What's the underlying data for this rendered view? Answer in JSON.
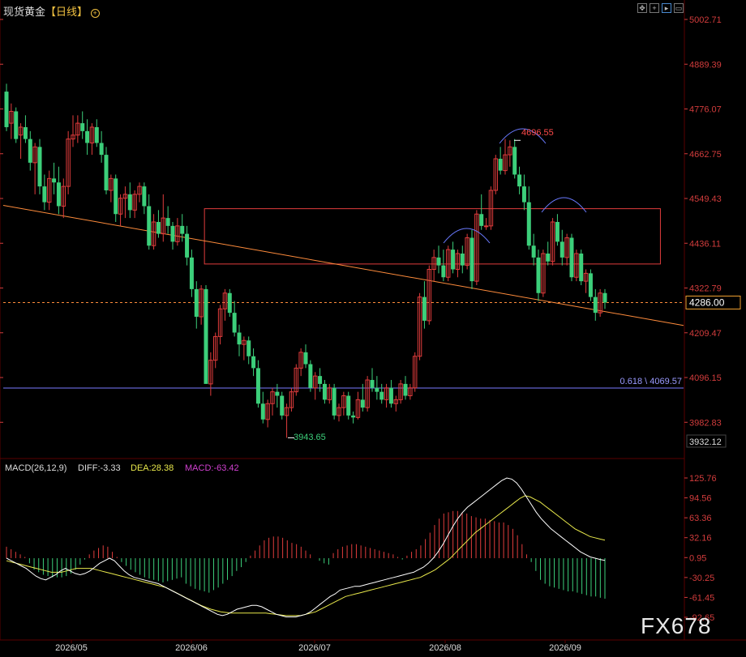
{
  "header": {
    "title": "现货黄金",
    "period": "【日线】",
    "settings_icon": "circle-plus-icon"
  },
  "toolbar": {
    "icons": [
      "move-icon",
      "crosshair-icon",
      "chart-mode-icon",
      "expand-icon"
    ]
  },
  "current_price": "4286.00",
  "watermark": "FX678",
  "colors": {
    "up": "#e03c3c",
    "down": "#3ccf7a",
    "grid": "#5a0000",
    "axis_text": "#d23c3c",
    "trend": "#ff8c3c",
    "fib": "#7a7aff",
    "box": "#e03c3c",
    "diff": "#ffffff",
    "dea": "#e8e84b",
    "arc": "#6a7aff"
  },
  "chart_data": [
    {
      "type": "candlestick",
      "title": "",
      "price_ticks": [
        "5002.71",
        "4889.39",
        "4776.07",
        "4662.75",
        "4549.43",
        "4436.11",
        "4322.79",
        "4209.47",
        "4096.15",
        "3982.83"
      ],
      "ylim": [
        3932.12,
        5002.71
      ],
      "ymin_label": "3932.12",
      "x_labels": [
        "2026/05",
        "2026/06",
        "2026/07",
        "2026/08",
        "2026/09"
      ],
      "annotations": {
        "high": "4696.55",
        "low": "3943.65",
        "fib": "0.618 \\ 4069.57"
      },
      "candles": [
        [
          4820,
          4840,
          4720,
          4730
        ],
        [
          4740,
          4790,
          4700,
          4770
        ],
        [
          4770,
          4780,
          4690,
          4700
        ],
        [
          4710,
          4740,
          4650,
          4730
        ],
        [
          4730,
          4760,
          4690,
          4700
        ],
        [
          4700,
          4720,
          4620,
          4640
        ],
        [
          4640,
          4690,
          4560,
          4680
        ],
        [
          4680,
          4700,
          4560,
          4580
        ],
        [
          4580,
          4610,
          4520,
          4540
        ],
        [
          4540,
          4620,
          4520,
          4600
        ],
        [
          4600,
          4640,
          4560,
          4590
        ],
        [
          4590,
          4630,
          4510,
          4530
        ],
        [
          4530,
          4600,
          4500,
          4580
        ],
        [
          4580,
          4720,
          4560,
          4700
        ],
        [
          4700,
          4760,
          4680,
          4710
        ],
        [
          4710,
          4760,
          4690,
          4740
        ],
        [
          4740,
          4770,
          4700,
          4720
        ],
        [
          4720,
          4750,
          4660,
          4690
        ],
        [
          4690,
          4740,
          4660,
          4730
        ],
        [
          4730,
          4750,
          4680,
          4690
        ],
        [
          4690,
          4720,
          4640,
          4660
        ],
        [
          4660,
          4680,
          4560,
          4570
        ],
        [
          4570,
          4610,
          4540,
          4600
        ],
        [
          4600,
          4610,
          4490,
          4510
        ],
        [
          4510,
          4560,
          4480,
          4550
        ],
        [
          4550,
          4580,
          4500,
          4560
        ],
        [
          4560,
          4590,
          4500,
          4520
        ],
        [
          4520,
          4570,
          4500,
          4560
        ],
        [
          4560,
          4590,
          4540,
          4580
        ],
        [
          4580,
          4590,
          4510,
          4530
        ],
        [
          4530,
          4560,
          4420,
          4430
        ],
        [
          4430,
          4510,
          4420,
          4490
        ],
        [
          4490,
          4520,
          4450,
          4460
        ],
        [
          4460,
          4560,
          4440,
          4500
        ],
        [
          4500,
          4530,
          4460,
          4480
        ],
        [
          4480,
          4490,
          4420,
          4440
        ],
        [
          4440,
          4500,
          4430,
          4480
        ],
        [
          4480,
          4510,
          4440,
          4460
        ],
        [
          4460,
          4480,
          4380,
          4400
        ],
        [
          4400,
          4420,
          4300,
          4320
        ],
        [
          4320,
          4340,
          4220,
          4250
        ],
        [
          4250,
          4330,
          4230,
          4320
        ],
        [
          4320,
          4330,
          4100,
          4080
        ],
        [
          4080,
          4160,
          4050,
          4140
        ],
        [
          4140,
          4210,
          4120,
          4200
        ],
        [
          4200,
          4280,
          4180,
          4270
        ],
        [
          4270,
          4320,
          4240,
          4310
        ],
        [
          4310,
          4320,
          4250,
          4260
        ],
        [
          4260,
          4290,
          4200,
          4210
        ],
        [
          4210,
          4230,
          4150,
          4180
        ],
        [
          4180,
          4200,
          4140,
          4190
        ],
        [
          4190,
          4200,
          4130,
          4150
        ],
        [
          4150,
          4170,
          4100,
          4120
        ],
        [
          4120,
          4140,
          4020,
          4030
        ],
        [
          4030,
          4060,
          3980,
          3990
        ],
        [
          3990,
          4040,
          3970,
          4030
        ],
        [
          4030,
          4070,
          4000,
          4060
        ],
        [
          4060,
          4080,
          4020,
          4050
        ],
        [
          4050,
          4060,
          3990,
          4000
        ],
        [
          4000,
          4030,
          3943.65,
          4020
        ],
        [
          4020,
          4070,
          4010,
          4060
        ],
        [
          4060,
          4130,
          4050,
          4120
        ],
        [
          4120,
          4170,
          4100,
          4160
        ],
        [
          4160,
          4180,
          4120,
          4130
        ],
        [
          4130,
          4140,
          4060,
          4070
        ],
        [
          4070,
          4110,
          4040,
          4100
        ],
        [
          4100,
          4120,
          4060,
          4080
        ],
        [
          4080,
          4090,
          4030,
          4040
        ],
        [
          4040,
          4080,
          4030,
          4070
        ],
        [
          4070,
          4080,
          3990,
          4000
        ],
        [
          4000,
          4030,
          3985,
          4020
        ],
        [
          4020,
          4060,
          4000,
          4050
        ],
        [
          4050,
          4060,
          3990,
          4000
        ],
        [
          4000,
          4010,
          3980,
          3995
        ],
        [
          3995,
          4060,
          3990,
          4040
        ],
        [
          4040,
          4080,
          4010,
          4020
        ],
        [
          4020,
          4100,
          4010,
          4090
        ],
        [
          4090,
          4120,
          4060,
          4070
        ],
        [
          4070,
          4100,
          4040,
          4060
        ],
        [
          4060,
          4080,
          4030,
          4040
        ],
        [
          4040,
          4080,
          4020,
          4070
        ],
        [
          4070,
          4090,
          4020,
          4030
        ],
        [
          4030,
          4050,
          4010,
          4040
        ],
        [
          4040,
          4090,
          4030,
          4080
        ],
        [
          4080,
          4100,
          4040,
          4050
        ],
        [
          4050,
          4080,
          4040,
          4070
        ],
        [
          4070,
          4160,
          4060,
          4150
        ],
        [
          4150,
          4310,
          4140,
          4300
        ],
        [
          4300,
          4340,
          4220,
          4240
        ],
        [
          4240,
          4380,
          4230,
          4370
        ],
        [
          4370,
          4420,
          4340,
          4400
        ],
        [
          4400,
          4430,
          4360,
          4380
        ],
        [
          4380,
          4420,
          4340,
          4350
        ],
        [
          4350,
          4430,
          4340,
          4420
        ],
        [
          4420,
          4440,
          4360,
          4370
        ],
        [
          4370,
          4420,
          4350,
          4410
        ],
        [
          4410,
          4430,
          4360,
          4380
        ],
        [
          4380,
          4460,
          4370,
          4450
        ],
        [
          4450,
          4470,
          4320,
          4340
        ],
        [
          4340,
          4520,
          4330,
          4510
        ],
        [
          4510,
          4560,
          4470,
          4480
        ],
        [
          4480,
          4500,
          4470,
          4480
        ],
        [
          4480,
          4580,
          4470,
          4570
        ],
        [
          4570,
          4660,
          4560,
          4650
        ],
        [
          4650,
          4680,
          4610,
          4620
        ],
        [
          4620,
          4700,
          4610,
          4660
        ],
        [
          4660,
          4696.55,
          4630,
          4680
        ],
        [
          4680,
          4700,
          4600,
          4610
        ],
        [
          4610,
          4630,
          4560,
          4580
        ],
        [
          4580,
          4610,
          4520,
          4540
        ],
        [
          4540,
          4580,
          4420,
          4430
        ],
        [
          4430,
          4460,
          4380,
          4400
        ],
        [
          4400,
          4420,
          4290,
          4310
        ],
        [
          4310,
          4420,
          4300,
          4410
        ],
        [
          4410,
          4440,
          4380,
          4390
        ],
        [
          4390,
          4500,
          4380,
          4490
        ],
        [
          4490,
          4510,
          4430,
          4440
        ],
        [
          4440,
          4470,
          4380,
          4400
        ],
        [
          4400,
          4460,
          4380,
          4450
        ],
        [
          4450,
          4460,
          4340,
          4350
        ],
        [
          4350,
          4420,
          4340,
          4410
        ],
        [
          4410,
          4420,
          4330,
          4340
        ],
        [
          4340,
          4370,
          4310,
          4360
        ],
        [
          4360,
          4370,
          4290,
          4300
        ],
        [
          4300,
          4320,
          4240,
          4260
        ],
        [
          4260,
          4320,
          4250,
          4310
        ],
        [
          4310,
          4320,
          4270,
          4286
        ]
      ],
      "trendline": [
        [
          4520,
          4240
        ]
      ],
      "box": {
        "top": 4540,
        "bottom": 4400,
        "from": 41,
        "to": 137
      },
      "fib_level": 4069.57
    },
    {
      "type": "macd",
      "title": "MACD(26,12,9)",
      "diff_label": "DIFF:-3.33",
      "dea_label": "DEA:28.38",
      "macd_label": "MACD:-63.42",
      "ticks": [
        "125.76",
        "94.56",
        "63.36",
        "32.16",
        "0.95",
        "-30.25",
        "-61.45",
        "-92.65"
      ],
      "ylim": [
        -92.65,
        125.76
      ],
      "histogram": [
        18,
        14,
        10,
        6,
        2,
        -8,
        -18,
        -22,
        -26,
        -28,
        -30,
        -30,
        -30,
        -28,
        -24,
        -18,
        -10,
        -2,
        6,
        12,
        16,
        20,
        18,
        10,
        2,
        -6,
        -12,
        -18,
        -22,
        -26,
        -30,
        -32,
        -34,
        -36,
        -38,
        -36,
        -34,
        -32,
        -30,
        -40,
        -44,
        -48,
        -50,
        -52,
        -54,
        -50,
        -46,
        -40,
        -34,
        -28,
        -20,
        -14,
        -6,
        4,
        12,
        20,
        28,
        32,
        34,
        34,
        32,
        28,
        24,
        22,
        18,
        12,
        6,
        0,
        -4,
        -8,
        -10,
        8,
        14,
        18,
        20,
        22,
        22,
        20,
        18,
        16,
        14,
        12,
        10,
        8,
        6,
        2,
        -2,
        4,
        10,
        14,
        20,
        30,
        40,
        52,
        62,
        70,
        72,
        74,
        74,
        72,
        70,
        66,
        64,
        62,
        62,
        60,
        58,
        56,
        56,
        52,
        46,
        36,
        22,
        6,
        -6,
        -20,
        -34,
        -40,
        -44,
        -46,
        -48,
        -50,
        -52,
        -52,
        -54,
        -56,
        -58,
        -60,
        -60,
        -62,
        -63.42
      ],
      "diff": [
        0,
        -4,
        -8,
        -12,
        -16,
        -22,
        -28,
        -32,
        -34,
        -30,
        -26,
        -20,
        -16,
        -20,
        -24,
        -26,
        -24,
        -20,
        -14,
        -8,
        -4,
        0,
        -4,
        -12,
        -20,
        -26,
        -30,
        -32,
        -34,
        -36,
        -38,
        -40,
        -44,
        -48,
        -52,
        -56,
        -60,
        -64,
        -68,
        -72,
        -76,
        -80,
        -84,
        -88,
        -90,
        -88,
        -84,
        -80,
        -78,
        -76,
        -74,
        -74,
        -76,
        -80,
        -84,
        -88,
        -90,
        -92,
        -92,
        -92,
        -90,
        -88,
        -84,
        -78,
        -72,
        -66,
        -60,
        -56,
        -50,
        -48,
        -46,
        -44,
        -44,
        -42,
        -40,
        -38,
        -36,
        -34,
        -32,
        -30,
        -28,
        -26,
        -24,
        -22,
        -18,
        -14,
        -8,
        0,
        10,
        22,
        36,
        50,
        62,
        72,
        80,
        86,
        92,
        98,
        104,
        110,
        116,
        122,
        125.76,
        124,
        118,
        108,
        96,
        84,
        72,
        62,
        54,
        46,
        40,
        34,
        28,
        22,
        16,
        10,
        6,
        2,
        0,
        -2,
        -3.33
      ],
      "dea": [
        -4,
        -6,
        -8,
        -10,
        -12,
        -14,
        -16,
        -18,
        -20,
        -22,
        -22,
        -22,
        -20,
        -18,
        -16,
        -16,
        -16,
        -16,
        -18,
        -20,
        -22,
        -24,
        -26,
        -28,
        -30,
        -32,
        -34,
        -36,
        -38,
        -40,
        -42,
        -44,
        -46,
        -50,
        -54,
        -58,
        -62,
        -66,
        -70,
        -74,
        -77,
        -80,
        -82,
        -84,
        -85,
        -86,
        -86,
        -86,
        -86,
        -86,
        -86,
        -86,
        -86,
        -87,
        -88,
        -89,
        -90,
        -90,
        -90,
        -90,
        -88,
        -86,
        -84,
        -80,
        -76,
        -72,
        -68,
        -64,
        -60,
        -58,
        -56,
        -54,
        -52,
        -50,
        -48,
        -46,
        -44,
        -42,
        -40,
        -38,
        -36,
        -34,
        -32,
        -30,
        -26,
        -22,
        -18,
        -12,
        -6,
        0,
        8,
        16,
        24,
        32,
        40,
        46,
        52,
        58,
        64,
        70,
        76,
        82,
        88,
        94,
        98,
        96,
        92,
        88,
        82,
        76,
        70,
        64,
        58,
        52,
        46,
        42,
        38,
        34,
        32,
        30,
        28.38
      ]
    }
  ]
}
